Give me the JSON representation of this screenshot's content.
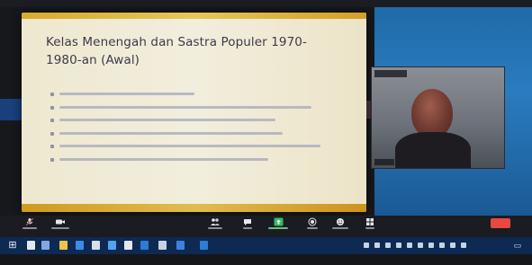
{
  "slide": {
    "title": "Kelas Menengah dan Sastra Populer 1970-1980-an (Awal)",
    "bullets": [
      {
        "text": ""
      },
      {
        "text": ""
      },
      {
        "text": ""
      },
      {
        "text": ""
      },
      {
        "text": ""
      },
      {
        "text": ""
      },
      {
        "text": ""
      }
    ]
  },
  "participant": {
    "name": "",
    "video_icon": "person-video"
  },
  "toolbar": {
    "items": [
      {
        "icon": "microphone-icon",
        "label": ""
      },
      {
        "icon": "video-camera-icon",
        "label": ""
      },
      {
        "icon": "participants-icon",
        "label": ""
      },
      {
        "icon": "chat-icon",
        "label": ""
      },
      {
        "icon": "share-screen-icon",
        "label": ""
      },
      {
        "icon": "record-icon",
        "label": ""
      },
      {
        "icon": "reactions-icon",
        "label": ""
      },
      {
        "icon": "apps-icon",
        "label": ""
      },
      {
        "icon": "whiteboard-icon",
        "label": ""
      }
    ],
    "end_label": "",
    "share_color": "#2fbf5f",
    "end_color": "#e8483f"
  },
  "taskbar": {
    "clock": "",
    "accent": "#0e2a52"
  }
}
